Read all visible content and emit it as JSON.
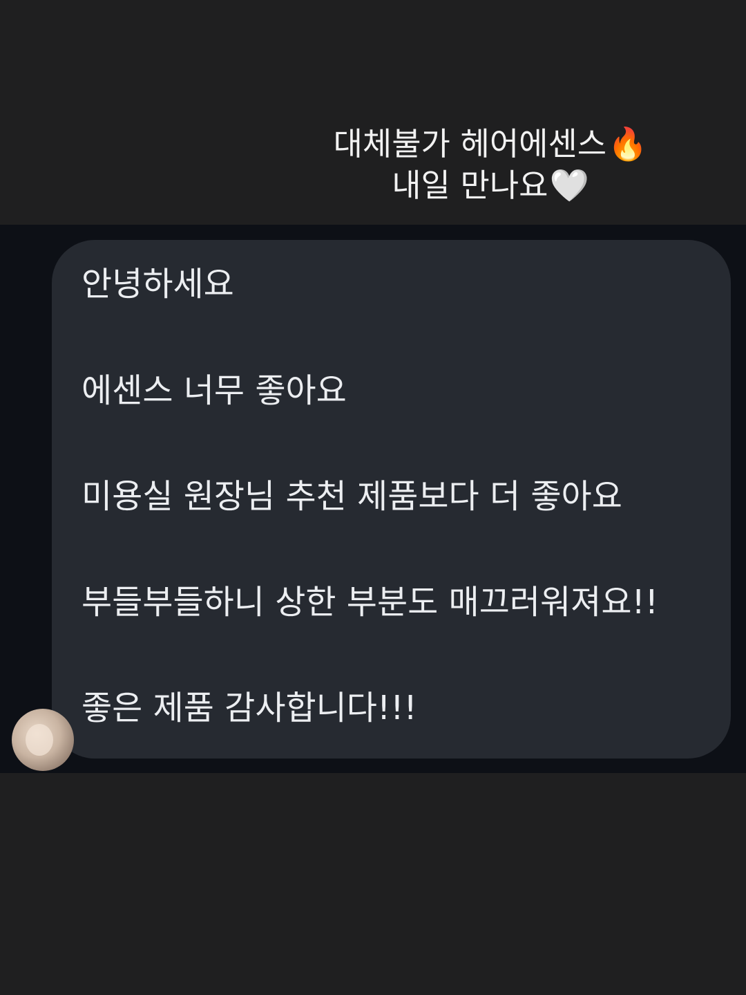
{
  "story_caption": {
    "line1": "대체불가 헤어에센스",
    "line1_emoji": "🔥",
    "line2": "내일 만나요",
    "line2_emoji": "🤍"
  },
  "message": {
    "lines": [
      "안녕하세요",
      "에센스 너무 좋아요",
      "미용실 원장님 추천 제품보다 더 좋아요",
      "부들부들하니 상한 부분도 매끄러워져요!!",
      "좋은 제품 감사합니다!!!"
    ]
  },
  "colors": {
    "page_background": "#1f1f20",
    "chat_background": "#0d1016",
    "bubble_background": "#262a31",
    "text": "#eceef1"
  }
}
